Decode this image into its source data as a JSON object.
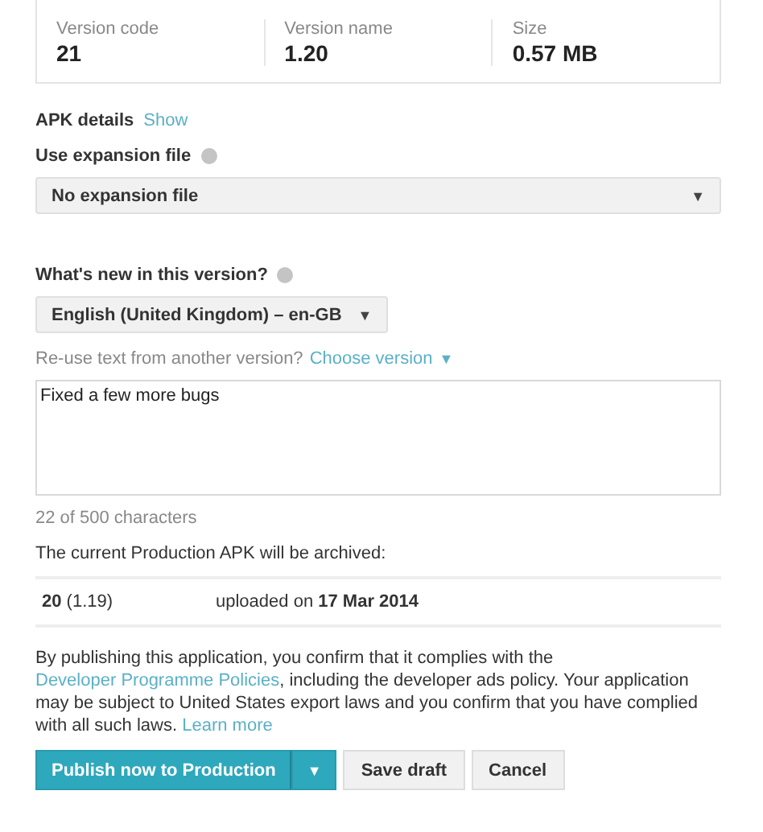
{
  "stats": [
    {
      "label": "Version code",
      "value": "21"
    },
    {
      "label": "Version name",
      "value": "1.20"
    },
    {
      "label": "Size",
      "value": "0.57 MB"
    }
  ],
  "apk_details": {
    "label": "APK details",
    "link": "Show"
  },
  "expansion": {
    "label": "Use expansion file",
    "value": "No expansion file",
    "caret": "▼"
  },
  "whats_new": {
    "label": "What's new in this version?",
    "language": "English (United Kingdom) – en-GB",
    "caret": "▼",
    "reuse_text": "Re-use text from another version?",
    "reuse_link": "Choose version",
    "reuse_caret": "▼",
    "value": "Fixed a few more bugs",
    "count": "22 of 500 characters"
  },
  "archive": {
    "note": "The current Production APK will be archived:",
    "version": "**20** (1.19)",
    "uploaded": "uploaded on **17 Mar 2014**"
  },
  "notice": [
    {
      "kind": "text",
      "text": "By publishing this application, you confirm that it complies with the "
    },
    {
      "kind": "link",
      "text": "Developer Programme Policies"
    },
    {
      "kind": "text",
      "text": ", including the developer ads policy. Your application may be subject to United States export laws and you confirm that you have complied with all such laws. "
    },
    {
      "kind": "link",
      "text": "Learn more"
    }
  ],
  "buttons": {
    "publish": "Publish now to Production",
    "publish_caret": "▼",
    "save": "Save draft",
    "cancel": "Cancel"
  }
}
